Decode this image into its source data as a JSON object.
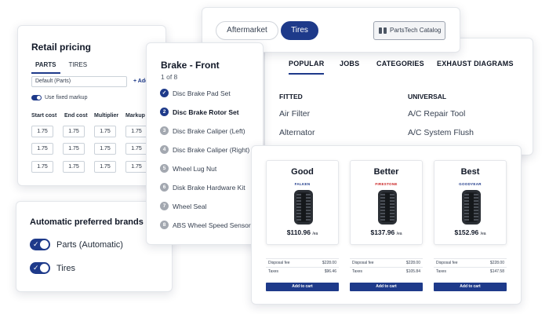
{
  "retail_pricing": {
    "title": "Retail pricing",
    "tabs": [
      "PARTS",
      "TIRES"
    ],
    "select_value": "Default (Parts)",
    "add_matrix": "+ Add matr",
    "fixed_markup_label": "Use fixed markup",
    "columns": [
      "Start cost",
      "End cost",
      "Multiplier",
      "Markup"
    ],
    "rows": [
      [
        "1.75",
        "1.75",
        "1.75",
        "1.75"
      ],
      [
        "1.75",
        "1.75",
        "1.75",
        "1.75"
      ],
      [
        "1.75",
        "1.75",
        "1.75",
        "1.75"
      ]
    ]
  },
  "preferred_brands": {
    "title": "Automatic preferred brands",
    "options": [
      {
        "label": "Parts (Automatic)",
        "checked": true
      },
      {
        "label": "Tires",
        "checked": true
      }
    ]
  },
  "top_tabs": {
    "aftermarket": "Aftermarket",
    "tires": "Tires",
    "catalog": "PartsTech Catalog"
  },
  "categories_panel": {
    "tabs": [
      "POPULAR",
      "JOBS",
      "CATEGORIES",
      "EXHAUST DIAGRAMS"
    ],
    "fitted": {
      "heading": "FITTED",
      "items": [
        "Air Filter",
        "Alternator"
      ]
    },
    "universal": {
      "heading": "UNIVERSAL",
      "items": [
        "A/C Repair Tool",
        "A/C System Flush"
      ]
    }
  },
  "brake": {
    "title": "Brake - Front",
    "count": "1 of 8",
    "steps": [
      {
        "num": "✓",
        "label": "Disc Brake Pad Set",
        "state": "done"
      },
      {
        "num": "2",
        "label": "Disc Brake Rotor Set",
        "state": "current"
      },
      {
        "num": "3",
        "label": "Disc Brake Caliper (Left)",
        "state": "todo"
      },
      {
        "num": "4",
        "label": "Disc Brake Caliper (Right)",
        "state": "todo"
      },
      {
        "num": "5",
        "label": "Wheel Lug Nut",
        "state": "todo"
      },
      {
        "num": "6",
        "label": "Disk Brake Hardware Kit",
        "state": "todo"
      },
      {
        "num": "7",
        "label": "Wheel Seal",
        "state": "todo"
      },
      {
        "num": "8",
        "label": "ABS Wheel Speed Sensor",
        "state": "todo"
      }
    ]
  },
  "tire_options": [
    {
      "grade": "Good",
      "brand": "FALKEN",
      "brand_color": "#1e3a8a",
      "price": "$110.96",
      "unit": "/ea",
      "disposal_label": "Disposal fee",
      "disposal": "$228.00",
      "taxes_label": "Taxes",
      "taxes": "$96.46",
      "cta": "Add to cart"
    },
    {
      "grade": "Better",
      "brand": "FIRESTONE",
      "brand_color": "#c81e1e",
      "price": "$137.96",
      "unit": "/ea",
      "disposal_label": "Disposal fee",
      "disposal": "$228.00",
      "taxes_label": "Taxes",
      "taxes": "$105.84",
      "cta": "Add to cart"
    },
    {
      "grade": "Best",
      "brand": "GOODYEAR",
      "brand_color": "#1e3a8a",
      "price": "$152.96",
      "unit": "/ea",
      "disposal_label": "Disposal fee",
      "disposal": "$228.00",
      "taxes_label": "Taxes",
      "taxes": "$147.58",
      "cta": "Add to cart"
    }
  ]
}
